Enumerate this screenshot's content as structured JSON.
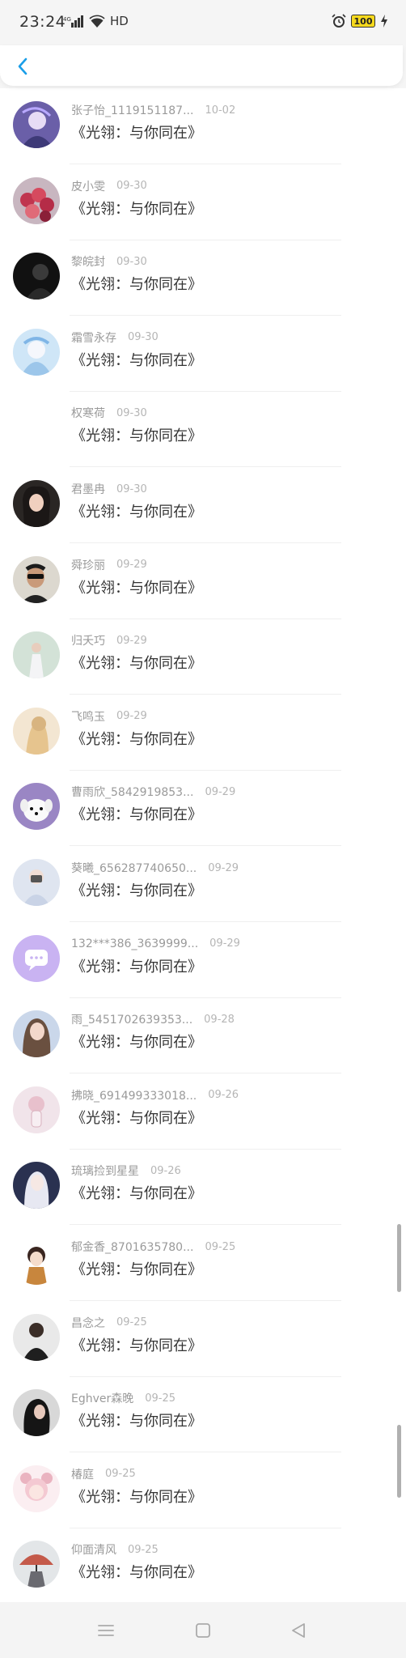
{
  "status_bar": {
    "time": "23:24",
    "network": "HD",
    "battery": "100",
    "icons": [
      "signal-icon",
      "wifi-icon",
      "alarm-icon",
      "battery-icon",
      "charging-icon"
    ]
  },
  "header": {
    "back_icon": "chevron-left-icon",
    "accent_color": "#1a9ee8"
  },
  "items": [
    {
      "name": "张子怡_1119151187...",
      "date": "10-02",
      "title": "《光翎：与你同在》",
      "avatar": "anime-girl-purple-avatar"
    },
    {
      "name": "皮小雯",
      "date": "09-30",
      "title": "《光翎：与你同在》",
      "avatar": "flowers-avatar"
    },
    {
      "name": "黎皖封",
      "date": "09-30",
      "title": "《光翎：与你同在》",
      "avatar": "dark-portrait-avatar"
    },
    {
      "name": "霜雪永存",
      "date": "09-30",
      "title": "《光翎：与你同在》",
      "avatar": "anime-ice-avatar"
    },
    {
      "name": "权寒荷",
      "date": "09-30",
      "title": "《光翎：与你同在》",
      "avatar": ""
    },
    {
      "name": "君墨冉",
      "date": "09-30",
      "title": "《光翎：与你同在》",
      "avatar": "girl-portrait-avatar"
    },
    {
      "name": "舜珍丽",
      "date": "09-29",
      "title": "《光翎：与你同在》",
      "avatar": "man-sunglasses-avatar"
    },
    {
      "name": "归夭巧",
      "date": "09-29",
      "title": "《光翎：与你同在》",
      "avatar": "girl-dress-avatar"
    },
    {
      "name": "飞鸣玉",
      "date": "09-29",
      "title": "《光翎：与你同在》",
      "avatar": "girl-back-avatar"
    },
    {
      "name": "曹雨欣_5842919853...",
      "date": "09-29",
      "title": "《光翎：与你同在》",
      "avatar": "white-dog-avatar"
    },
    {
      "name": "葵曦_656287740650...",
      "date": "09-29",
      "title": "《光翎：与你同在》",
      "avatar": "girl-camera-avatar"
    },
    {
      "name": "132***386_3639999...",
      "date": "09-29",
      "title": "《光翎：与你同在》",
      "avatar": "default-chat-avatar"
    },
    {
      "name": "雨_5451702639353...",
      "date": "09-28",
      "title": "《光翎：与你同在》",
      "avatar": "girl-long-hair-avatar"
    },
    {
      "name": "拂晓_691499333018...",
      "date": "09-26",
      "title": "《光翎：与你同在》",
      "avatar": "pink-bottle-avatar"
    },
    {
      "name": "琉璃捡到星星",
      "date": "09-26",
      "title": "《光翎：与你同在》",
      "avatar": "anime-white-hair-avatar"
    },
    {
      "name": "郁金香_8701635780...",
      "date": "09-25",
      "title": "《光翎：与你同在》",
      "avatar": "cartoon-girl-avatar"
    },
    {
      "name": "昌念之",
      "date": "09-25",
      "title": "《光翎：与你同在》",
      "avatar": "man-dark-avatar"
    },
    {
      "name": "Eghver森晚",
      "date": "09-25",
      "title": "《光翎：与你同在》",
      "avatar": "girl-dark-hair-avatar"
    },
    {
      "name": "椿庭",
      "date": "09-25",
      "title": "《光翎：与你同在》",
      "avatar": "anime-pink-avatar"
    },
    {
      "name": "仰面清风",
      "date": "09-25",
      "title": "《光翎：与你同在》",
      "avatar": "person-umbrella-avatar"
    }
  ],
  "nav_bar": {
    "icons": [
      "menu-icon",
      "home-square-icon",
      "back-triangle-icon"
    ]
  }
}
